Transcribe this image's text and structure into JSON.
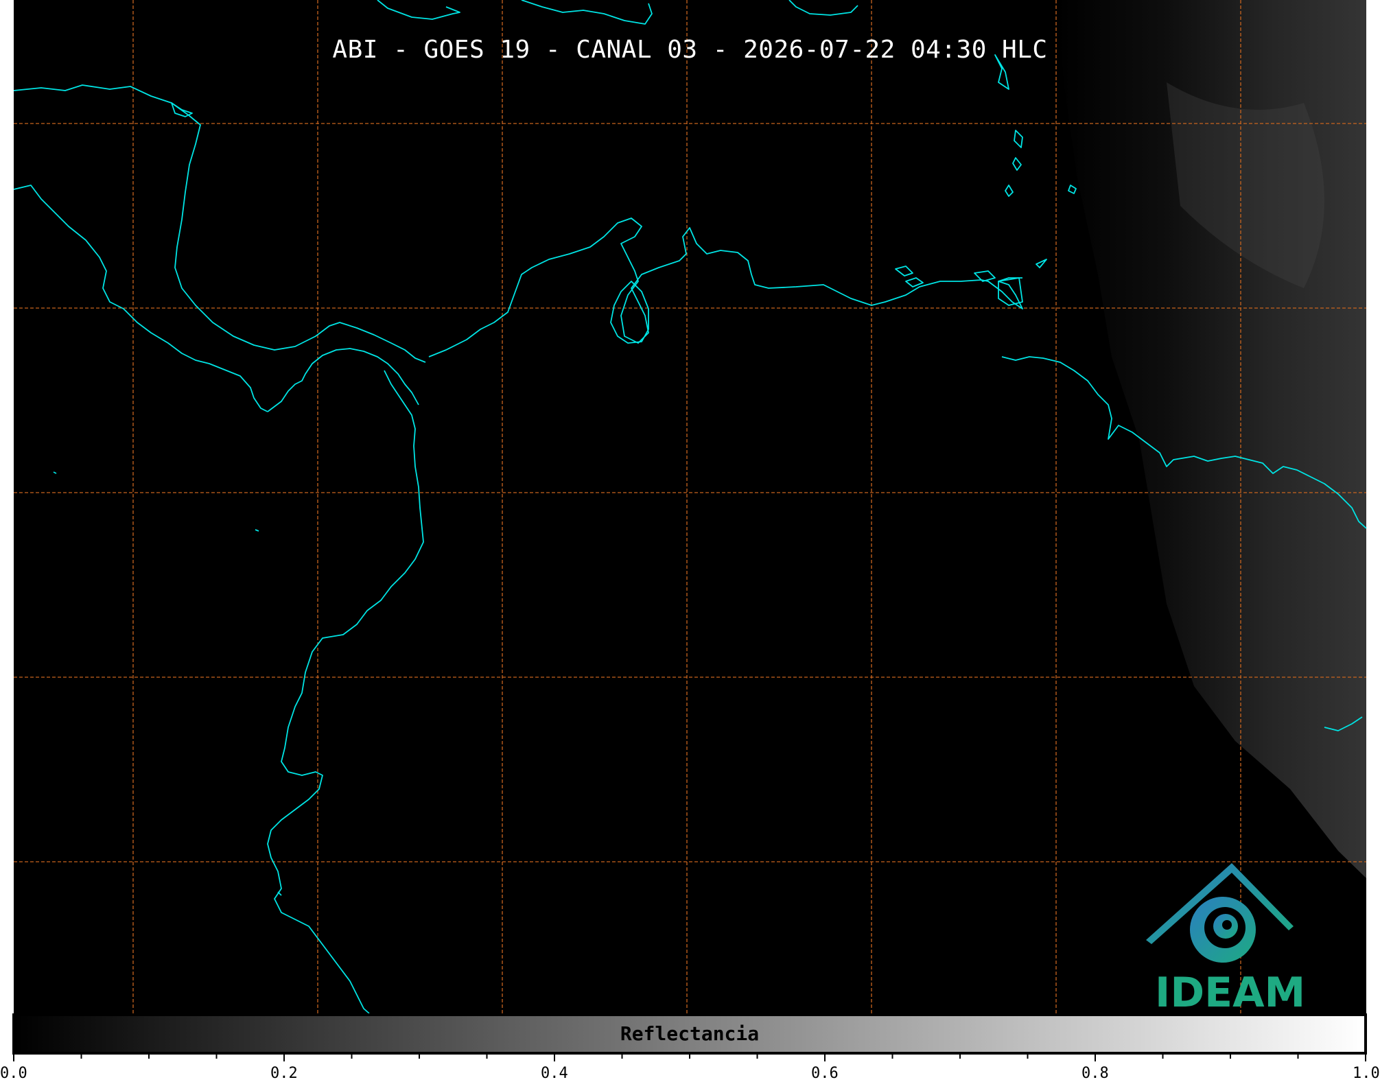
{
  "title": "ABI - GOES 19 - CANAL 03 - 2026-07-22 04:30 HLC",
  "logo": {
    "text": "IDEAM"
  },
  "colorbar": {
    "label": "Reflectancia",
    "ticks": [
      "0.0",
      "0.2",
      "0.4",
      "0.6",
      "0.8",
      "1.0"
    ],
    "colors": {
      "start": "#000000",
      "end": "#ffffff"
    }
  },
  "colors": {
    "background": "#000000",
    "coastline": "#00e5e5",
    "gridline": "#c8641e",
    "logo_blue": "#2a7fc0",
    "logo_teal": "#1eaa82"
  }
}
